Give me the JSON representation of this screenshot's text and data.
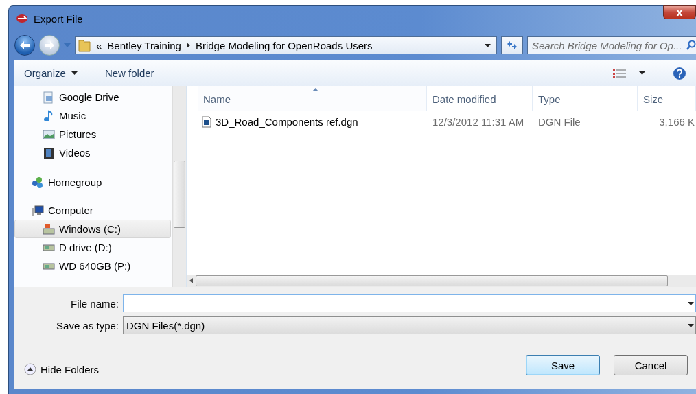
{
  "window": {
    "title": "Export File",
    "close": "x"
  },
  "address_bar": {
    "overflow": "«",
    "crumbs": [
      "Bentley Training",
      "Bridge Modeling for OpenRoads Users"
    ]
  },
  "search": {
    "placeholder": "Search Bridge Modeling for Op..."
  },
  "toolbar": {
    "buttons": [
      {
        "label": "Organize",
        "dropdown": true
      },
      {
        "label": "New folder",
        "dropdown": false
      }
    ]
  },
  "sidebar": {
    "sections": [
      {
        "children": [
          {
            "label": "Google Drive",
            "kind": "drive",
            "selected": false
          },
          {
            "label": "Music",
            "kind": "music",
            "selected": false
          },
          {
            "label": "Pictures",
            "kind": "pictures",
            "selected": false
          },
          {
            "label": "Videos",
            "kind": "videos",
            "selected": false
          }
        ]
      },
      {
        "label": "Homegroup",
        "kind": "homegroup",
        "selected": false
      },
      {
        "label": "Computer",
        "kind": "computer",
        "selected": false,
        "children": [
          {
            "label": "Windows (C:)",
            "kind": "system-disk",
            "selected": true
          },
          {
            "label": "D drive (D:)",
            "kind": "disk",
            "selected": false
          },
          {
            "label": "WD 640GB (P:)",
            "kind": "disk",
            "selected": false
          }
        ]
      }
    ]
  },
  "table": {
    "columns": [
      {
        "label": "Name",
        "sorted": true
      },
      {
        "label": "Date modified",
        "sorted": false
      },
      {
        "label": "Type",
        "sorted": false
      },
      {
        "label": "Size",
        "sorted": false
      }
    ],
    "rows": [
      {
        "cells": [
          "3D_Road_Components ref.dgn",
          "12/3/2012 11:31 AM",
          "DGN File",
          "3,166 K"
        ],
        "selected": false
      }
    ]
  },
  "form": {
    "fields": [
      {
        "label": "File name:",
        "kind": "combo"
      },
      {
        "label": "Save as type:",
        "kind": "select",
        "value": "DGN Files(*.dgn)"
      }
    ]
  },
  "footer": {
    "toggle": "Hide Folders",
    "buttons": [
      {
        "label": "Save",
        "default": true
      },
      {
        "label": "Cancel",
        "default": false
      }
    ]
  }
}
